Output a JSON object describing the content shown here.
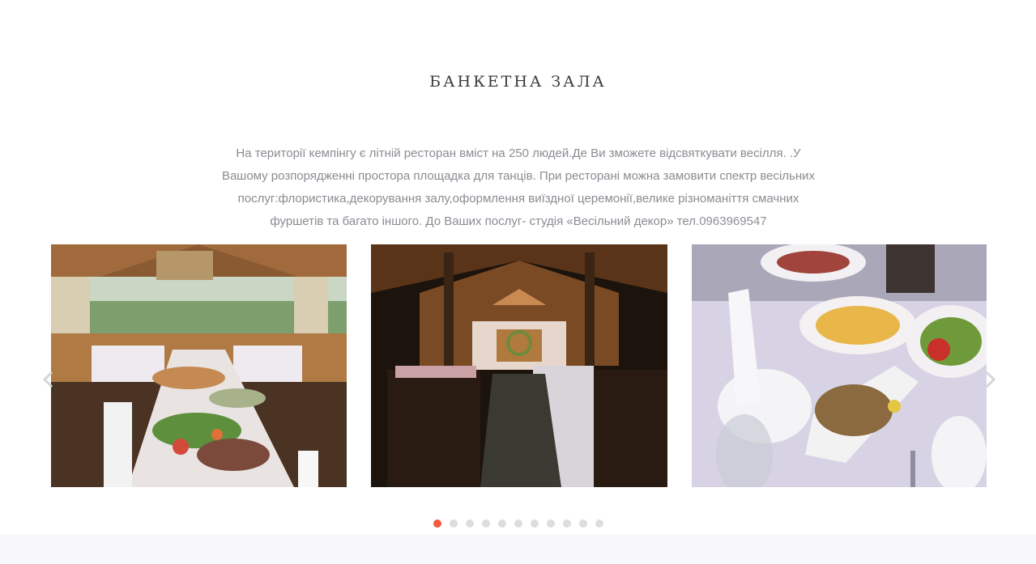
{
  "section": {
    "title": "БАНКЕТНА ЗАЛА",
    "description_parts": [
      "На території кемпінгу є літній ресторан вміст на ",
      "250",
      " людей.Де Ви зможете відсвяткувати весілля. .У Вашому розпорядженні простора площадка для танців. При ресторані можна замовити спектр весільних послуг:флористика,декорування залу,оформлення виїздної церемонії,велике різноманіття смачних фуршетів та багато іншого. До Ваших послуг- студія «Весільний декор» тел.",
      "0963969547"
    ]
  },
  "carousel": {
    "slides": [
      {
        "photo": "banquet-buffet-table-photo"
      },
      {
        "photo": "wooden-hall-interior-photo"
      },
      {
        "photo": "served-food-plates-photo"
      }
    ],
    "dot_count": 11,
    "active_index": 0,
    "icons": {
      "prev": "chevron-left-icon",
      "next": "chevron-right-icon"
    }
  },
  "colors": {
    "accent": "#f15a3a",
    "dot_inactive": "#dddddd",
    "title": "#3a3a3a",
    "text": "#8b8b93",
    "band": "#f8f8fc"
  }
}
